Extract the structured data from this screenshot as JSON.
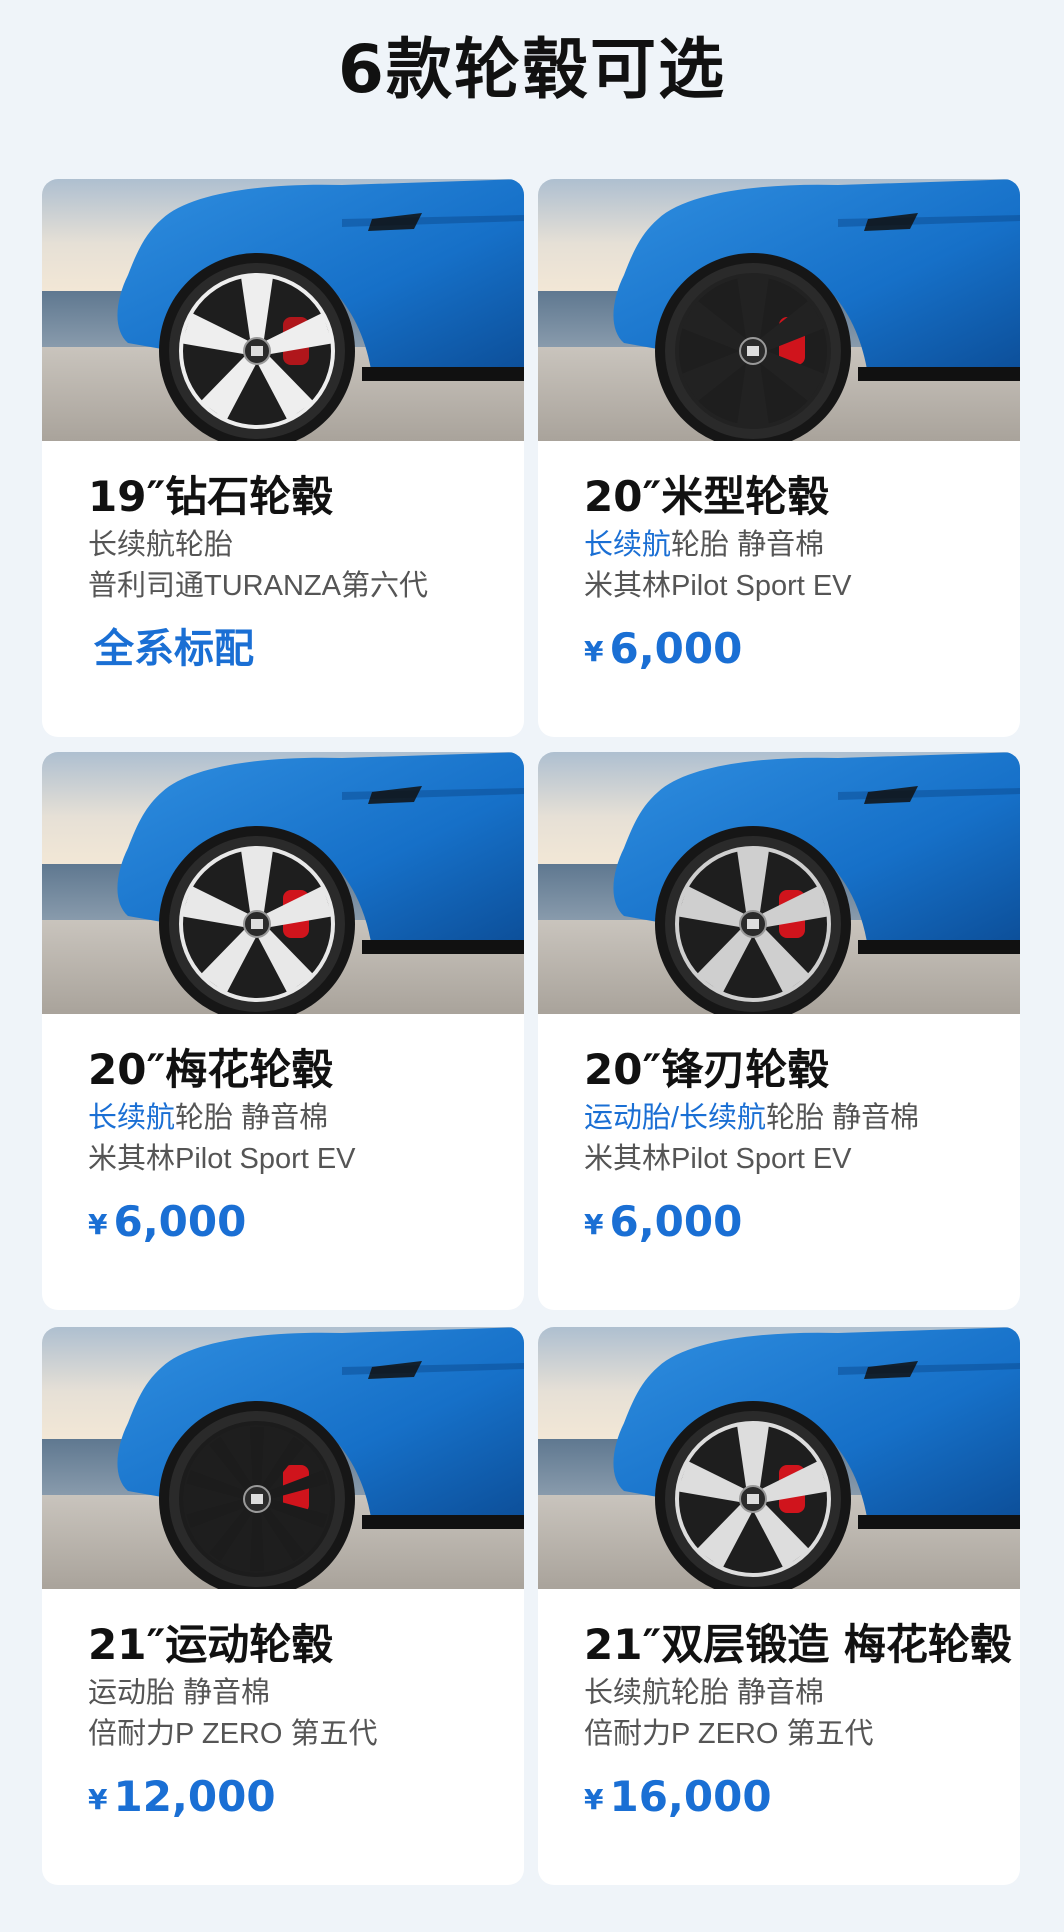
{
  "title": "6款轮毂可选",
  "wheels": [
    {
      "name": "19″钻石轮毂",
      "line1_highlight": "",
      "line1_rest": "长续航轮胎",
      "line2": "普利司通TURANZA第六代",
      "price_symbol": "",
      "price": "全系标配",
      "rim_color": "#eeeeee",
      "caliper_color": "#b0161b",
      "spoke_count": 5
    },
    {
      "name": "20″米型轮毂",
      "line1_highlight": "长续航",
      "line1_rest": "轮胎 静音棉",
      "line2": "米其林Pilot Sport EV",
      "price_symbol": "¥",
      "price": "6,000",
      "rim_color": "#222222",
      "caliper_color": "#d0141c",
      "spoke_count": 6
    },
    {
      "name": "20″梅花轮毂",
      "line1_highlight": "长续航",
      "line1_rest": "轮胎 静音棉",
      "line2": "米其林Pilot Sport EV",
      "price_symbol": "¥",
      "price": "6,000",
      "rim_color": "#e8e8e8",
      "caliper_color": "#d0141c",
      "spoke_count": 5
    },
    {
      "name": "20″锋刃轮毂",
      "line1_highlight": "运动胎/长续航",
      "line1_rest": "轮胎 静音棉",
      "line2": "米其林Pilot Sport EV",
      "price_symbol": "¥",
      "price": "6,000",
      "rim_color": "#cfcfcf",
      "caliper_color": "#d0141c",
      "spoke_count": 5
    },
    {
      "name": "21″运动轮毂",
      "line1_highlight": "",
      "line1_rest": "运动胎 静音棉",
      "line2": "倍耐力P ZERO 第五代",
      "price_symbol": "¥",
      "price": "12,000",
      "rim_color": "#1c1c1c",
      "caliper_color": "#d0141c",
      "spoke_count": 10
    },
    {
      "name": "21″双层锻造 梅花轮毂",
      "line1_highlight": "",
      "line1_rest": "长续航轮胎 静音棉",
      "line2": "倍耐力P ZERO 第五代",
      "price_symbol": "¥",
      "price": "16,000",
      "rim_color": "#dddddd",
      "caliper_color": "#d0141c",
      "spoke_count": 5
    }
  ]
}
